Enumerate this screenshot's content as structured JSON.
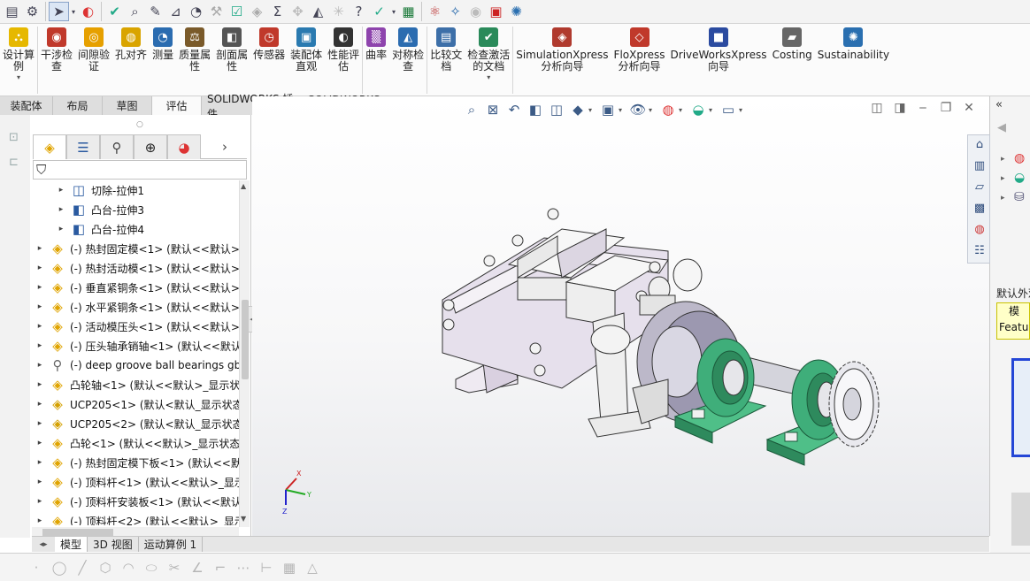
{
  "app": {
    "ribbon": {
      "items": [
        {
          "label": "设计算\n例",
          "icon": "design-table-icon",
          "has_dropdown": true
        },
        {
          "label": "干涉检\n查",
          "icon": "interference-check-icon"
        },
        {
          "label": "间隙验\n证",
          "icon": "clearance-check-icon"
        },
        {
          "label": "孔对齐",
          "icon": "hole-alignment-icon"
        },
        {
          "label": "测量",
          "icon": "measure-icon"
        },
        {
          "label": "质量属\n性",
          "icon": "mass-properties-icon"
        },
        {
          "label": "剖面属\n性",
          "icon": "section-properties-icon"
        },
        {
          "label": "传感器",
          "icon": "sensor-icon"
        },
        {
          "label": "装配体\n直观",
          "icon": "assembly-visualization-icon"
        },
        {
          "label": "性能评\n估",
          "icon": "performance-evaluation-icon"
        },
        {
          "label": "曲率",
          "icon": "curvature-icon"
        },
        {
          "label": "对称检\n查",
          "icon": "symmetry-check-icon"
        },
        {
          "label": "比较文\n档",
          "icon": "compare-documents-icon"
        },
        {
          "label": "检查激活\n的文档",
          "icon": "check-document-icon",
          "has_dropdown": true
        },
        {
          "label": "SimulationXpress\n分析向导",
          "icon": "simulationxpress-icon"
        },
        {
          "label": "FloXpress\n分析向导",
          "icon": "floxpress-icon"
        },
        {
          "label": "DriveWorksXpress\n向导",
          "icon": "driveworksxpress-icon"
        },
        {
          "label": "Costing",
          "icon": "costing-icon"
        },
        {
          "label": "Sustainability",
          "icon": "sustainability-icon"
        }
      ]
    },
    "command_tabs": [
      "装配体",
      "布局",
      "草图",
      "评估",
      "SOLIDWORKS 插件",
      "SOLIDWORKS MBD"
    ],
    "active_command_tab": "评估",
    "feature_tree": {
      "rows": [
        {
          "label": "切除-拉伸1",
          "icon": "cut-extrude-icon",
          "level": 1
        },
        {
          "label": "凸台-拉伸3",
          "icon": "boss-extrude-icon",
          "level": 1
        },
        {
          "label": "凸台-拉伸4",
          "icon": "boss-extrude-icon",
          "level": 1
        },
        {
          "label": "(-) 热封固定模<1> (默认<<默认>",
          "icon": "part-icon",
          "level": 0
        },
        {
          "label": "(-) 热封活动模<1> (默认<<默认>",
          "icon": "part-icon",
          "level": 0
        },
        {
          "label": "(-) 垂直紧铜条<1> (默认<<默认>",
          "icon": "part-icon",
          "level": 0
        },
        {
          "label": "(-) 水平紧铜条<1> (默认<<默认>",
          "icon": "part-icon",
          "level": 0
        },
        {
          "label": "(-) 活动模压头<1> (默认<<默认>",
          "icon": "part-icon",
          "level": 0
        },
        {
          "label": "(-) 压头轴承销轴<1> (默认<<默认",
          "icon": "part-icon",
          "level": 0
        },
        {
          "label": "(-) deep groove ball bearings gb",
          "icon": "toolbox-part-icon",
          "level": 0
        },
        {
          "label": "凸轮轴<1> (默认<<默认>_显示状",
          "icon": "part-icon",
          "level": 0
        },
        {
          "label": "UCP205<1> (默认<默认_显示状态",
          "icon": "assembly-icon",
          "level": 0
        },
        {
          "label": "UCP205<2> (默认<默认_显示状态",
          "icon": "assembly-icon",
          "level": 0
        },
        {
          "label": "凸轮<1> (默认<<默认>_显示状态",
          "icon": "part-icon",
          "level": 0
        },
        {
          "label": "(-) 热封固定模下板<1> (默认<<默",
          "icon": "part-icon",
          "level": 0
        },
        {
          "label": "(-) 顶料杆<1> (默认<<默认>_显示",
          "icon": "part-icon",
          "level": 0
        },
        {
          "label": "(-) 顶料杆安装板<1> (默认<<默认",
          "icon": "part-icon",
          "level": 0
        },
        {
          "label": "(-) 顶料杆<2> (默认<<默认>_显示",
          "icon": "part-icon",
          "level": 0
        }
      ]
    },
    "bottom_tabs": [
      "模型",
      "3D 视图",
      "运动算例 1"
    ],
    "active_bottom_tab": "模型",
    "task_pane": {
      "tag_label": "默认外观",
      "yellow_box_lines": [
        "模",
        "Featur"
      ]
    },
    "colors": {
      "accent": "#2446d6",
      "bearing_green": "#3fae7a",
      "part_grey": "#d9d4dd"
    }
  }
}
